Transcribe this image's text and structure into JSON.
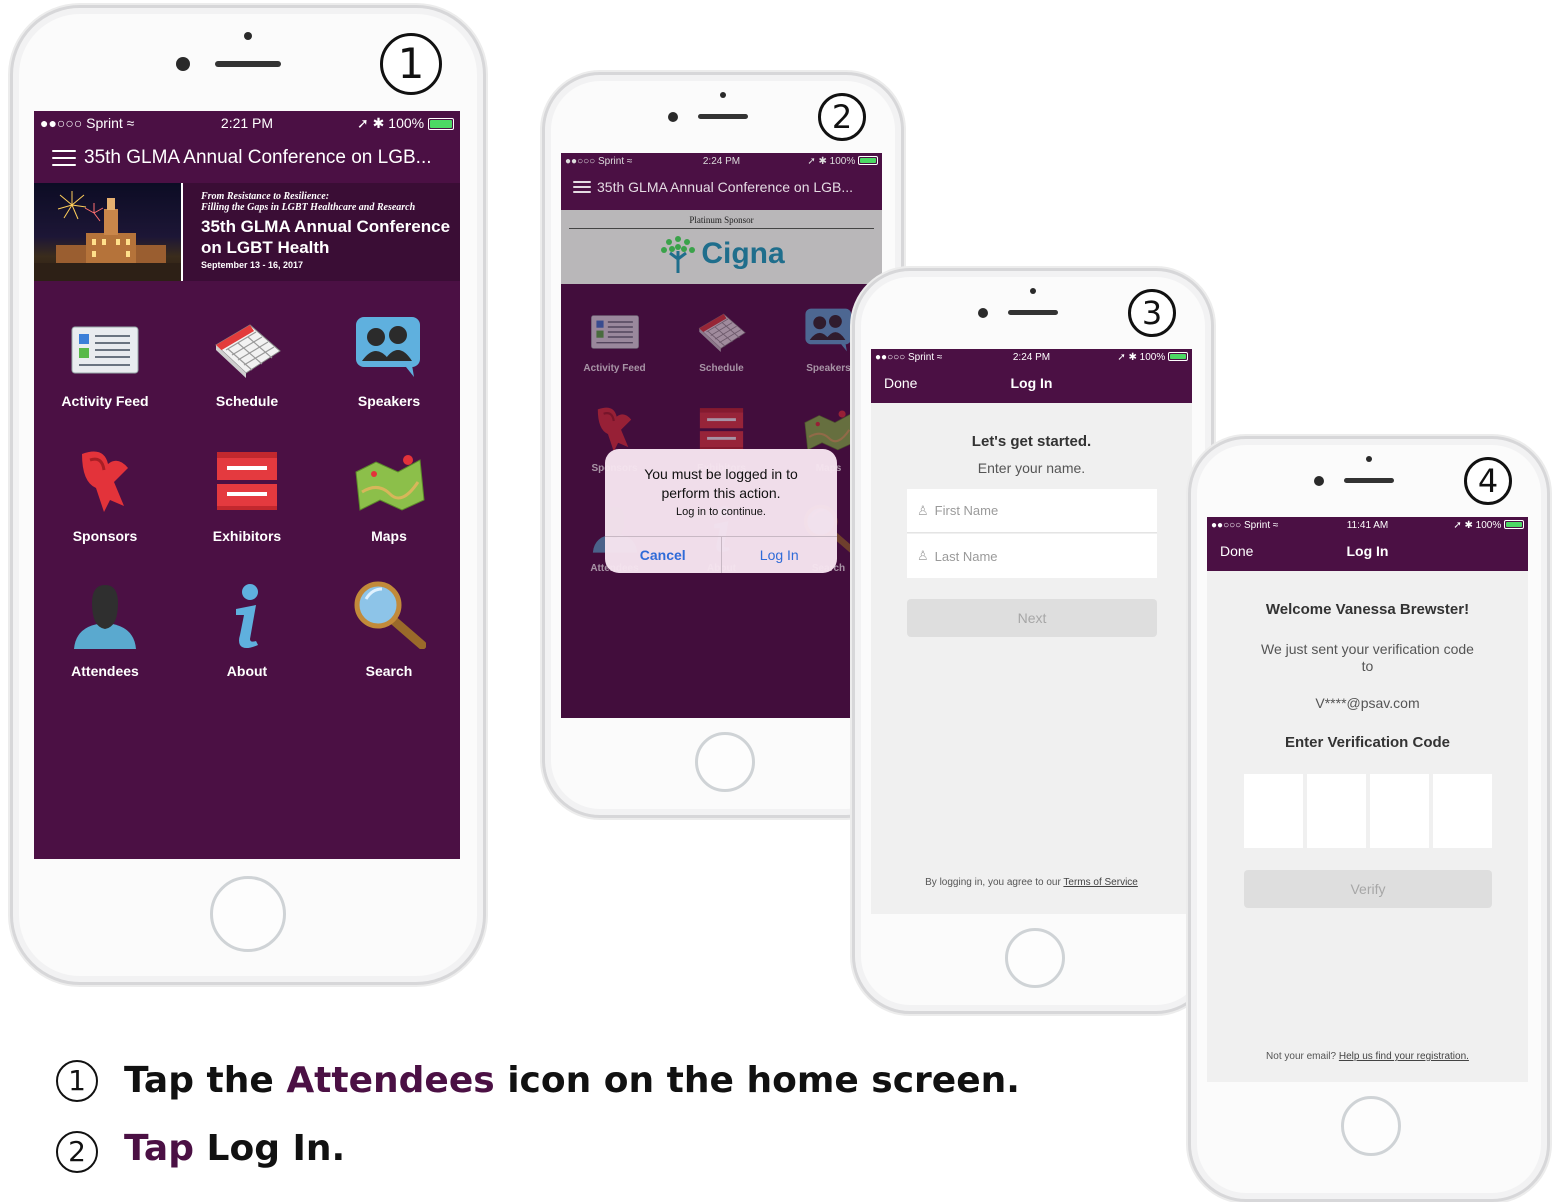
{
  "phone1": {
    "step": "1",
    "status": {
      "carrier": "●●○○○ Sprint",
      "wifi": "≈",
      "time": "2:21 PM",
      "icons": "➚ ✱",
      "battery": "100%"
    },
    "nav_title": "35th GLMA Annual Conference on LGB...",
    "banner": {
      "tagline1": "From Resistance to Resilience:",
      "tagline2": "Filling the Gaps in LGBT Healthcare and Research",
      "title_line1": "35th GLMA Annual Conference",
      "title_line2": "on LGBT Health",
      "dates": "September 13 - 16, 2017"
    },
    "tiles": [
      {
        "label": "Activity Feed",
        "icon": "news-icon"
      },
      {
        "label": "Schedule",
        "icon": "calendar-icon"
      },
      {
        "label": "Speakers",
        "icon": "speakers-icon"
      },
      {
        "label": "Sponsors",
        "icon": "ribbon-icon"
      },
      {
        "label": "Exhibitors",
        "icon": "booth-icon"
      },
      {
        "label": "Maps",
        "icon": "map-icon"
      },
      {
        "label": "Attendees",
        "icon": "person-icon"
      },
      {
        "label": "About",
        "icon": "info-icon"
      },
      {
        "label": "Search",
        "icon": "magnifier-icon"
      }
    ]
  },
  "phone2": {
    "step": "2",
    "status": {
      "carrier": "●●○○○ Sprint",
      "wifi": "≈",
      "time": "2:24 PM",
      "icons": "➚ ✱",
      "battery": "100%"
    },
    "nav_title": "35th GLMA Annual Conference on LGB...",
    "sponsor_heading": "Platinum Sponsor",
    "sponsor_name": "Cigna",
    "tiles_visible": [
      "Activity Feed",
      "Schedule",
      "Speakers",
      "Sponsors",
      "Exhibitors",
      "Maps",
      "Attendees",
      "About",
      "Search"
    ],
    "alert": {
      "title": "You must be logged in to perform this action.",
      "message": "Log in to continue.",
      "cancel": "Cancel",
      "login": "Log In"
    }
  },
  "phone3": {
    "step": "3",
    "status": {
      "carrier": "●●○○○ Sprint",
      "wifi": "≈",
      "time": "2:24 PM",
      "icons": "➚ ✱",
      "battery": "100%"
    },
    "done": "Done",
    "title": "Log In",
    "heading": "Let's get started.",
    "subheading": "Enter your name.",
    "first_name_placeholder": "First Name",
    "last_name_placeholder": "Last Name",
    "next": "Next",
    "terms_prefix": "By logging in, you agree to our ",
    "terms_link": "Terms of Service"
  },
  "phone4": {
    "step": "4",
    "status": {
      "carrier": "●●○○○ Sprint",
      "wifi": "≈",
      "time": "11:41 AM",
      "icons": "➚ ✱",
      "battery": "100%"
    },
    "done": "Done",
    "title": "Log In",
    "welcome": "Welcome Vanessa Brewster!",
    "sent_line1": "We just sent your verification code",
    "sent_line2": "to",
    "email": "V****@psav.com",
    "enter_code": "Enter Verification Code",
    "verify": "Verify",
    "not_email": "Not your email? ",
    "help_link": "Help us find your registration."
  },
  "captions": [
    {
      "num": "1",
      "pre": "Tap the ",
      "highlight": "Attendees",
      "post": " icon on the home screen."
    },
    {
      "num": "2",
      "highlight": "Tap",
      "post": " Log In."
    }
  ],
  "colors": {
    "brand_purple": "#4b1044",
    "alert_blue": "#2f6bd8",
    "battery_green": "#4cd964"
  }
}
